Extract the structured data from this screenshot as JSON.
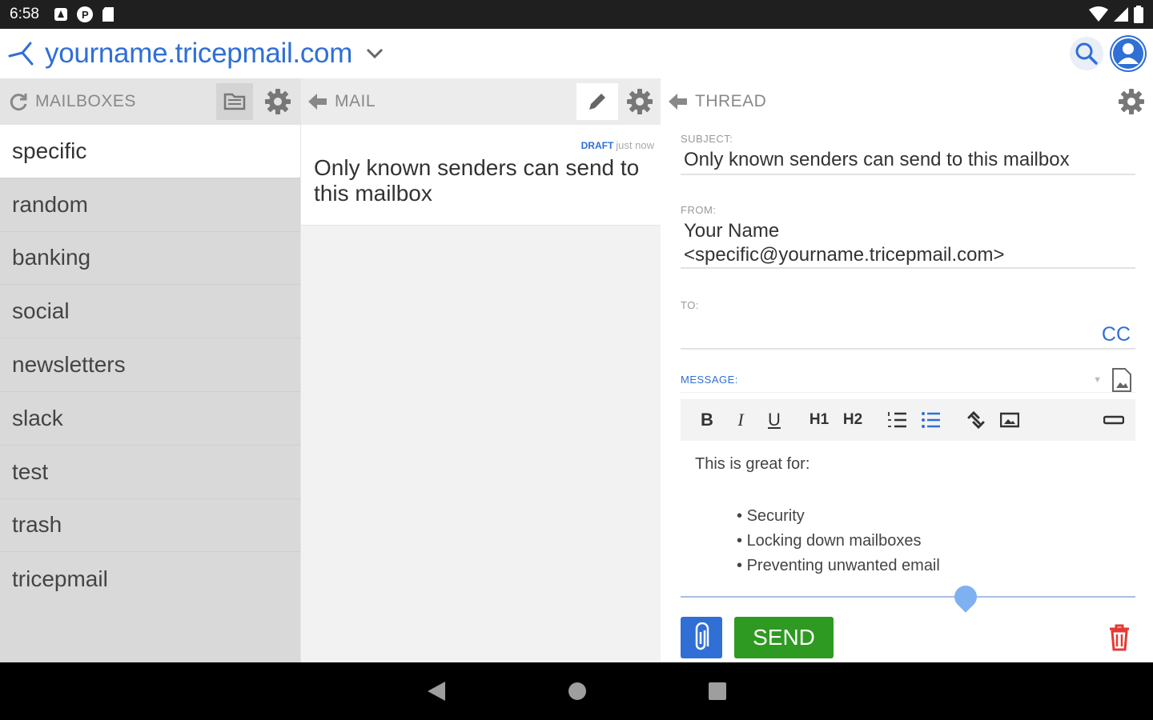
{
  "status_bar": {
    "time": "6:58"
  },
  "app_bar": {
    "domain": "yourname.tricepmail.com"
  },
  "mailboxes": {
    "header_label": "MAILBOXES",
    "items": [
      {
        "label": "specific",
        "selected": true
      },
      {
        "label": "random"
      },
      {
        "label": "banking"
      },
      {
        "label": "social"
      },
      {
        "label": "newsletters"
      },
      {
        "label": "slack"
      },
      {
        "label": "test"
      },
      {
        "label": "trash"
      },
      {
        "label": "tricepmail"
      }
    ]
  },
  "mail": {
    "header_label": "MAIL",
    "items": [
      {
        "tag": "DRAFT",
        "time": "just now",
        "subject": "Only known senders can send to this mailbox"
      }
    ]
  },
  "thread": {
    "header_label": "THREAD",
    "subject_label": "SUBJECT:",
    "subject": "Only known senders can send to this mailbox",
    "from_label": "FROM:",
    "from_name": "Your Name",
    "from_address": "<specific@yourname.tricepmail.com>",
    "to_label": "TO:",
    "to_value": "",
    "cc_label": "CC",
    "message_label": "MESSAGE:",
    "toolbar": {
      "h1": "H1",
      "h2": "H2"
    },
    "body_intro": "This is great for:",
    "body_bullets": [
      "Security",
      "Locking down mailboxes",
      "Preventing unwanted email"
    ],
    "send_label": "SEND"
  },
  "colors": {
    "accent": "#2f6fd6",
    "send": "#2e9a21",
    "danger": "#e53935"
  }
}
